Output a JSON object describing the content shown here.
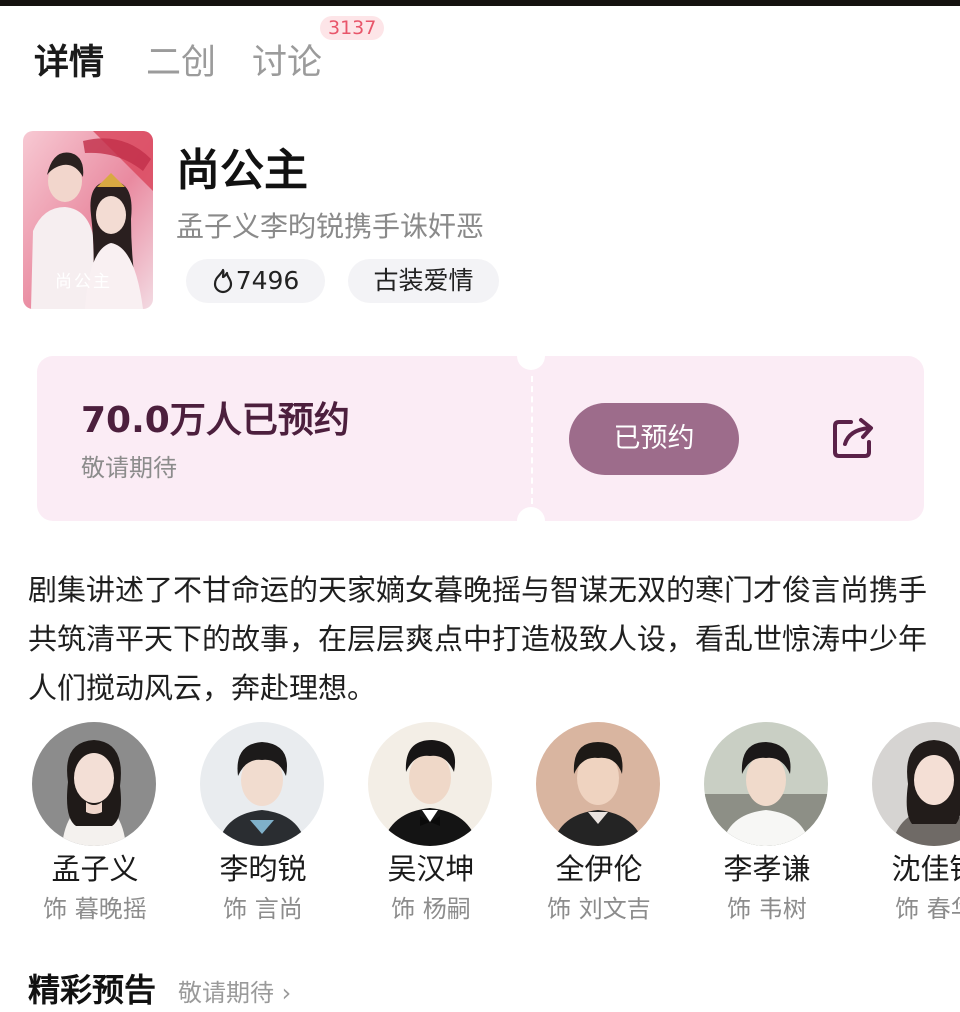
{
  "tabs": [
    {
      "label": "详情",
      "active": true
    },
    {
      "label": "二创",
      "active": false
    },
    {
      "label": "讨论",
      "active": false,
      "badge": "3137"
    }
  ],
  "show": {
    "title": "尚公主",
    "subtitle": "孟子义李昀锐携手诛奸恶",
    "poster_caption": "尚公主",
    "heat": "7496",
    "heat_icon": "flame-icon",
    "genre": "古装爱情"
  },
  "reservation": {
    "count_text": "70.0万人已预约",
    "sub_text": "敬请期待",
    "button_label": "已预约",
    "share_icon": "share-icon",
    "colors": {
      "card_bg": "#fbecf5",
      "button_bg": "#9d6c8b",
      "count_text": "#4c1f3d"
    }
  },
  "synopsis": "剧集讲述了不甘命运的天家嫡女暮晚摇与智谋无双的寒门才俊言尚携手共筑清平天下的故事，在层层爽点中打造极致人设，看乱世惊涛中少年人们搅动风云，奔赴理想。",
  "cast": [
    {
      "name": "孟子义",
      "role": "饰 暮晚摇"
    },
    {
      "name": "李昀锐",
      "role": "饰 言尚"
    },
    {
      "name": "吴汉坤",
      "role": "饰 杨嗣"
    },
    {
      "name": "全伊伦",
      "role": "饰 刘文吉"
    },
    {
      "name": "李孝谦",
      "role": "饰 韦树"
    },
    {
      "name": "沈佳钰",
      "role": "饰 春华"
    }
  ],
  "next_section": {
    "title": "精彩预告",
    "subtitle": "敬请期待 ›"
  }
}
